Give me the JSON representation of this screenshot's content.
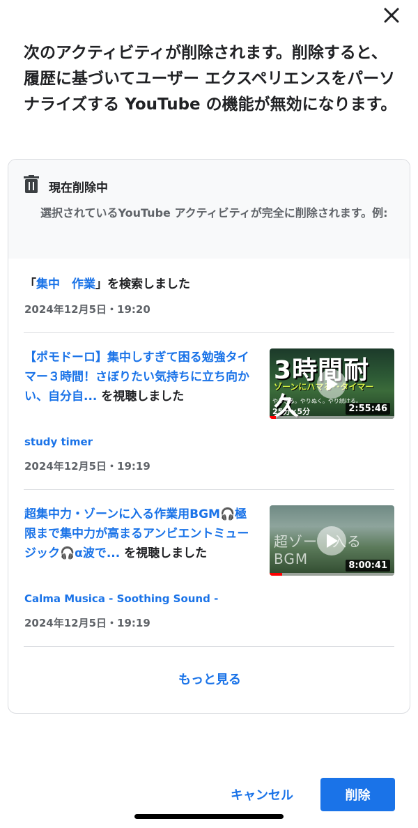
{
  "dialog": {
    "heading": "次のアクティビティが削除されます。削除すると、履歴に基づいてユーザー エクスペリエンスをパーソナライズする YouTube の機能が無効になります。",
    "close_icon": "close-icon"
  },
  "card": {
    "title": "現在削除中",
    "description": "選択されているYouTube アクティビティが完全に削除されます。例:",
    "icon": "trash-icon"
  },
  "items": [
    {
      "type": "search",
      "prefix": "「",
      "query": "集中　作業",
      "suffix": "」を検索しました",
      "timestamp": "2024年12月5日・19:20"
    },
    {
      "type": "watch",
      "title": "【ポモドーロ】集中しすぎて困る勉強タイマー３時間！さぼりたい気持ちに立ち向かい、自分自...",
      "suffix": " を視聴しました",
      "channel": "study timer",
      "timestamp": "2024年12月5日・19:19",
      "thumb_big": "3時間耐久",
      "thumb_sub": "ゾーンにハマる･･タイマー",
      "thumb_small": "やりきる。やりぬく。やり続ける。",
      "thumb_bottom": "25分×5分",
      "duration": "2:55:46",
      "progress": 0.05
    },
    {
      "type": "watch",
      "title": "超集中力・ゾーンに入る作業用BGM🎧極限まで集中力が高まるアンビエントミュージック🎧α波で...",
      "suffix": " を視聴しました",
      "channel": "Calma Musica - Soothing Sound -",
      "timestamp": "2024年12月5日・19:19",
      "thumb_overlay": "超ゾー　入るBGM",
      "duration": "8:00:41",
      "progress": 0.1
    }
  ],
  "more_label": "もっと見る",
  "buttons": {
    "cancel": "キャンセル",
    "delete": "削除"
  },
  "colors": {
    "accent": "#1a73e8",
    "progress": "#ff0000"
  }
}
